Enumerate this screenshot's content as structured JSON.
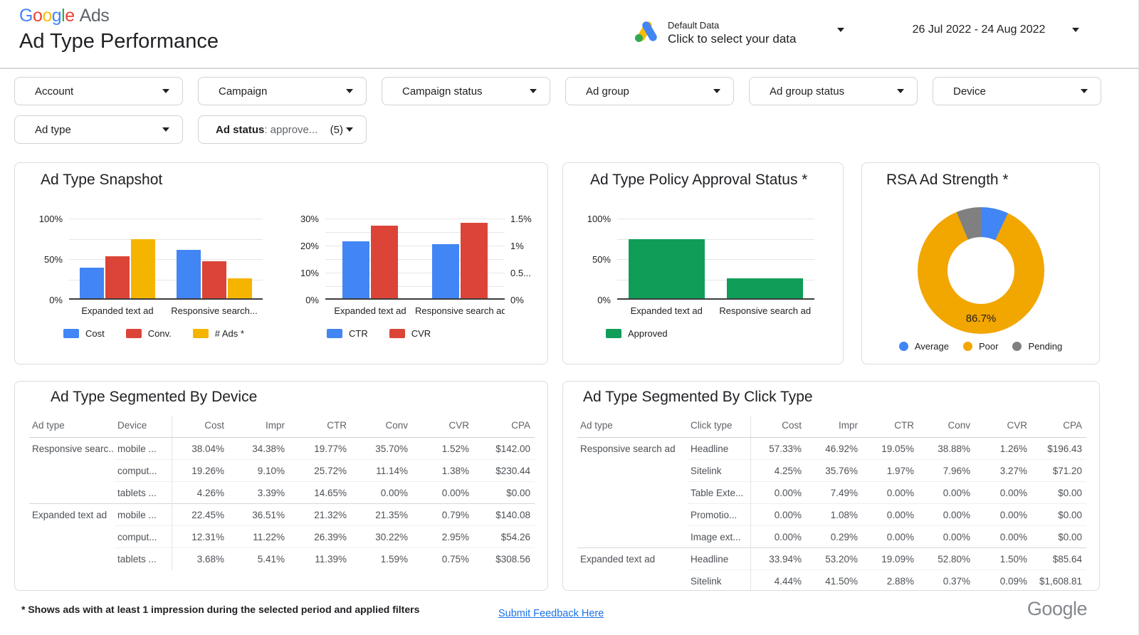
{
  "header": {
    "logo": {
      "letters": [
        {
          "ch": "G",
          "color": "#4285F4"
        },
        {
          "ch": "o",
          "color": "#EA4335"
        },
        {
          "ch": "o",
          "color": "#FBBC05"
        },
        {
          "ch": "g",
          "color": "#4285F4"
        },
        {
          "ch": "l",
          "color": "#34A853"
        },
        {
          "ch": "e",
          "color": "#EA4335"
        }
      ],
      "suffix": "Ads"
    },
    "title": "Ad Type Performance",
    "data_selector": {
      "primary": "Default Data",
      "secondary": "Click to select your data"
    },
    "date_range": "26 Jul 2022 - 24 Aug 2022"
  },
  "filters": {
    "row1": [
      "Account",
      "Campaign",
      "Campaign status",
      "Ad group",
      "Ad group status",
      "Device"
    ],
    "row2": [
      "Ad type"
    ],
    "ad_status": {
      "label": "Ad status",
      "value": ": approve...",
      "count": "(5)"
    }
  },
  "chart_data": [
    {
      "id": "snapshot_share",
      "type": "bar",
      "title": "Ad Type Snapshot",
      "categories": [
        "Expanded text ad",
        "Responsive search..."
      ],
      "series": [
        {
          "name": "Cost",
          "color": "#4285F4",
          "values": [
            38,
            61
          ]
        },
        {
          "name": "Conv.",
          "color": "#DB4437",
          "values": [
            53,
            46
          ]
        },
        {
          "name": "# Ads *",
          "color": "#F4B400",
          "values": [
            74,
            25
          ]
        }
      ],
      "ylim": [
        0,
        100
      ],
      "yticks": [
        "100%",
        "50%",
        "0%"
      ],
      "grid_divisions": 4,
      "legend_position": "bottom"
    },
    {
      "id": "snapshot_rates",
      "type": "bar",
      "categories": [
        "Expanded text ad",
        "Responsive search ad"
      ],
      "series": [
        {
          "name": "CTR",
          "color": "#4285F4",
          "axis": "left",
          "values": [
            21.3,
            20.3
          ]
        },
        {
          "name": "CVR",
          "color": "#DB4437",
          "axis": "right",
          "values": [
            1.36,
            1.42
          ]
        }
      ],
      "ylim_left": [
        0,
        30
      ],
      "ylim_right": [
        0,
        1.5
      ],
      "yticks_left": [
        "30%",
        "20%",
        "10%",
        "0%"
      ],
      "yticks_right": [
        "1.5%",
        "1%",
        "0.5...",
        "0%"
      ],
      "grid_divisions": 6,
      "legend_position": "bottom"
    },
    {
      "id": "approval",
      "type": "bar",
      "title": "Ad Type Policy Approval Status *",
      "categories": [
        "Expanded text ad",
        "Responsive search ad"
      ],
      "series": [
        {
          "name": "Approved",
          "color": "#0F9D58",
          "values": [
            74,
            25
          ]
        }
      ],
      "ylim": [
        0,
        100
      ],
      "yticks": [
        "100%",
        "50%",
        "0%"
      ],
      "grid_divisions": 4,
      "legend_position": "bottom"
    },
    {
      "id": "rsa_strength",
      "type": "pie",
      "title": "RSA Ad Strength *",
      "slices": [
        {
          "name": "Average",
          "color": "#4285F4",
          "value": 7.0
        },
        {
          "name": "Poor",
          "color": "#F2A600",
          "value": 86.7
        },
        {
          "name": "Pending",
          "color": "#808080",
          "value": 6.3
        }
      ],
      "label": "86.7%",
      "legend_position": "bottom"
    }
  ],
  "tables": {
    "device": {
      "title": "Ad Type Segmented By Device",
      "columns": [
        "Ad type",
        "Device",
        "Cost",
        "Impr",
        "CTR",
        "Conv",
        "CVR",
        "CPA"
      ],
      "rows": [
        [
          "Responsive searc...",
          "mobile ...",
          "38.04%",
          "34.38%",
          "19.77%",
          "35.70%",
          "1.52%",
          "$142.00"
        ],
        [
          "",
          "comput...",
          "19.26%",
          "9.10%",
          "25.72%",
          "11.14%",
          "1.38%",
          "$230.44"
        ],
        [
          "",
          "tablets ...",
          "4.26%",
          "3.39%",
          "14.65%",
          "0.00%",
          "0.00%",
          "$0.00"
        ],
        [
          "Expanded text ad",
          "mobile ...",
          "22.45%",
          "36.51%",
          "21.32%",
          "21.35%",
          "0.79%",
          "$140.08"
        ],
        [
          "",
          "comput...",
          "12.31%",
          "11.22%",
          "26.39%",
          "30.22%",
          "2.95%",
          "$54.26"
        ],
        [
          "",
          "tablets ...",
          "3.68%",
          "5.41%",
          "11.39%",
          "1.59%",
          "0.75%",
          "$308.56"
        ]
      ],
      "group_starts": [
        0,
        3
      ]
    },
    "click_type": {
      "title": "Ad Type Segmented By Click Type",
      "columns": [
        "Ad type",
        "Click type",
        "Cost",
        "Impr",
        "CTR",
        "Conv",
        "CVR",
        "CPA"
      ],
      "rows": [
        [
          "Responsive search ad",
          "Headline",
          "57.33%",
          "46.92%",
          "19.05%",
          "38.88%",
          "1.26%",
          "$196.43"
        ],
        [
          "",
          "Sitelink",
          "4.25%",
          "35.76%",
          "1.97%",
          "7.96%",
          "3.27%",
          "$71.20"
        ],
        [
          "",
          "Table Exte...",
          "0.00%",
          "7.49%",
          "0.00%",
          "0.00%",
          "0.00%",
          "$0.00"
        ],
        [
          "",
          "Promotio...",
          "0.00%",
          "1.08%",
          "0.00%",
          "0.00%",
          "0.00%",
          "$0.00"
        ],
        [
          "",
          "Image ext...",
          "0.00%",
          "0.29%",
          "0.00%",
          "0.00%",
          "0.00%",
          "$0.00"
        ],
        [
          "Expanded text ad",
          "Headline",
          "33.94%",
          "53.20%",
          "19.09%",
          "52.80%",
          "1.50%",
          "$85.64"
        ],
        [
          "",
          "Sitelink",
          "4.44%",
          "41.50%",
          "2.88%",
          "0.37%",
          "0.09%",
          "$1,608.81"
        ]
      ],
      "group_starts": [
        0,
        5
      ]
    }
  },
  "footer": {
    "note": "* Shows ads with at least 1 impression during the selected period and applied filters",
    "feedback_link": "Submit Feedback Here",
    "google_logo": "Google"
  }
}
